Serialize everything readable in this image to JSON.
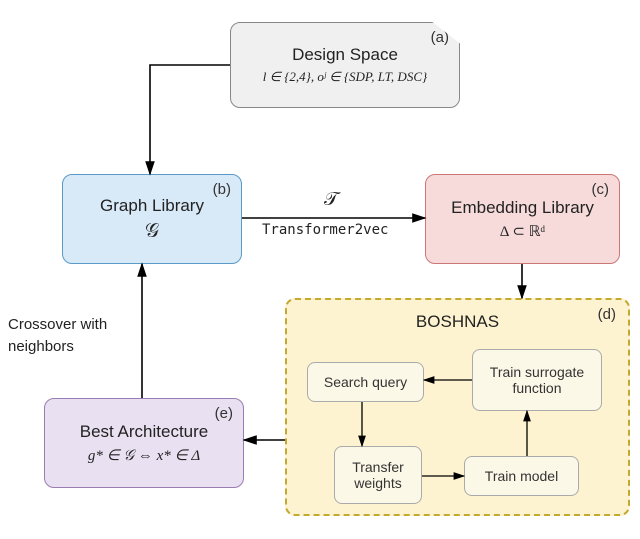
{
  "nodes": {
    "a": {
      "tag": "(a)",
      "title": "Design Space",
      "math": "l ∈ {2,4}, oʲ ∈ {SDP, LT, DSC}"
    },
    "b": {
      "tag": "(b)",
      "title": "Graph Library",
      "math": "𝒢"
    },
    "c": {
      "tag": "(c)",
      "title": "Embedding Library",
      "math": "Δ ⊂ ℝᵈ"
    },
    "d": {
      "tag": "(d)",
      "title": "BOSHNAS"
    },
    "e": {
      "tag": "(e)",
      "title": "Best Architecture",
      "math": "g* ∈ 𝒢 ⇔ x* ∈ Δ"
    }
  },
  "inner": {
    "sq": "Search query",
    "ts": "Train surrogate function",
    "tw": "Transfer weights",
    "tm": "Train model"
  },
  "edges": {
    "bc_top": "𝒯",
    "bc_bot": "Transformer2vec",
    "eb_l1": "Crossover with",
    "eb_l2": "neighbors"
  },
  "chart_data": {
    "type": "table",
    "description": "Flowchart pipeline",
    "nodes": [
      {
        "id": "a",
        "label": "Design Space",
        "detail": "l ∈ {2,4}, oʲ ∈ {SDP, LT, DSC}"
      },
      {
        "id": "b",
        "label": "Graph Library",
        "detail": "𝒢"
      },
      {
        "id": "c",
        "label": "Embedding Library",
        "detail": "Δ ⊂ ℝᵈ"
      },
      {
        "id": "d",
        "label": "BOSHNAS",
        "contains": [
          "Search query",
          "Train surrogate function",
          "Transfer weights",
          "Train model"
        ]
      },
      {
        "id": "e",
        "label": "Best Architecture",
        "detail": "g* ∈ 𝒢 ⇔ x* ∈ Δ"
      }
    ],
    "edges": [
      {
        "from": "a",
        "to": "b"
      },
      {
        "from": "b",
        "to": "c",
        "label": "𝒯 / Transformer2vec"
      },
      {
        "from": "c",
        "to": "d"
      },
      {
        "from": "d",
        "to": "e"
      },
      {
        "from": "e",
        "to": "b",
        "label": "Crossover with neighbors"
      },
      {
        "from": "Search query",
        "to": "Transfer weights"
      },
      {
        "from": "Transfer weights",
        "to": "Train model"
      },
      {
        "from": "Train model",
        "to": "Train surrogate function"
      },
      {
        "from": "Train surrogate function",
        "to": "Search query"
      }
    ]
  }
}
